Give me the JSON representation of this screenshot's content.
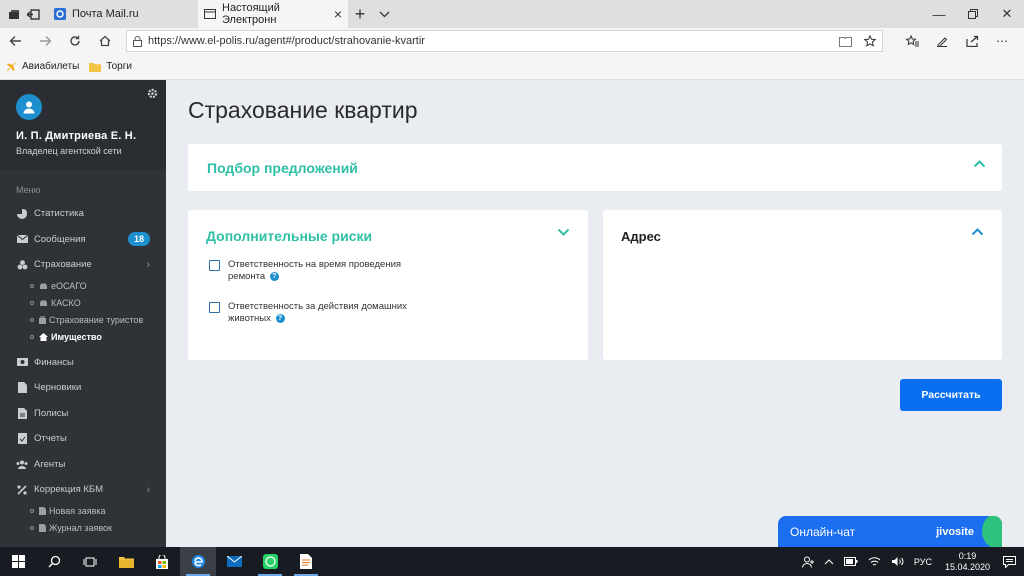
{
  "browser": {
    "tabs": [
      {
        "title": "Почта Mail.ru",
        "active": false
      },
      {
        "title": "Настоящий Электронн",
        "active": true
      }
    ],
    "url": "https://www.el-polis.ru/agent#/product/strahovanie-kvartir",
    "favorites": [
      {
        "label": "Авиабилеты",
        "icon": "plane-icon"
      },
      {
        "label": "Торги",
        "icon": "folder-icon"
      }
    ]
  },
  "sidebar": {
    "user_name": "И. П. Дмитриева Е. Н.",
    "user_role": "Владелец агентской сети",
    "menu_title": "Меню",
    "items": [
      {
        "label": "Статистика",
        "icon": "pie-chart-icon"
      },
      {
        "label": "Сообщения",
        "icon": "envelope-icon",
        "badge": "18"
      },
      {
        "label": "Страхование",
        "icon": "umbrella-icon"
      },
      {
        "label": "Финансы",
        "icon": "money-icon"
      },
      {
        "label": "Черновики",
        "icon": "draft-icon"
      },
      {
        "label": "Полисы",
        "icon": "document-icon"
      },
      {
        "label": "Отчеты",
        "icon": "report-icon"
      },
      {
        "label": "Агенты",
        "icon": "users-icon"
      },
      {
        "label": "Коррекция КБМ",
        "icon": "percent-icon"
      }
    ],
    "insurance_sub": [
      {
        "label": "еОСАГО",
        "icon": "car-icon"
      },
      {
        "label": "КАСКО",
        "icon": "car-icon"
      },
      {
        "label": "Страхование туристов",
        "icon": "suitcase-icon"
      },
      {
        "label": "Имущество",
        "icon": "home-icon",
        "active": true
      }
    ],
    "kbm_sub": [
      {
        "label": "Новая заявка",
        "icon": "file-icon"
      },
      {
        "label": "Журнал заявок",
        "icon": "list-icon"
      }
    ]
  },
  "main": {
    "title": "Страхование квартир",
    "offers_title": "Подбор предложений",
    "risks_title": "Дополнительные риски",
    "risk_options": [
      {
        "label": "Ответственность на время проведения ремонта",
        "checked": false
      },
      {
        "label": "Ответственность за действия домашних животных",
        "checked": false
      }
    ],
    "address_title": "Адрес",
    "calculate_label": "Рассчитать"
  },
  "chat": {
    "label": "Онлайн-чат",
    "brand": "jivosite"
  },
  "taskbar": {
    "lang": "РУС",
    "time": "0:19",
    "date": "15.04.2020"
  },
  "colors": {
    "accent_teal": "#2fbfa7",
    "primary_blue": "#0a6ef2",
    "sidebar_bg": "#2f3337",
    "badge_blue": "#1d8fcf"
  }
}
